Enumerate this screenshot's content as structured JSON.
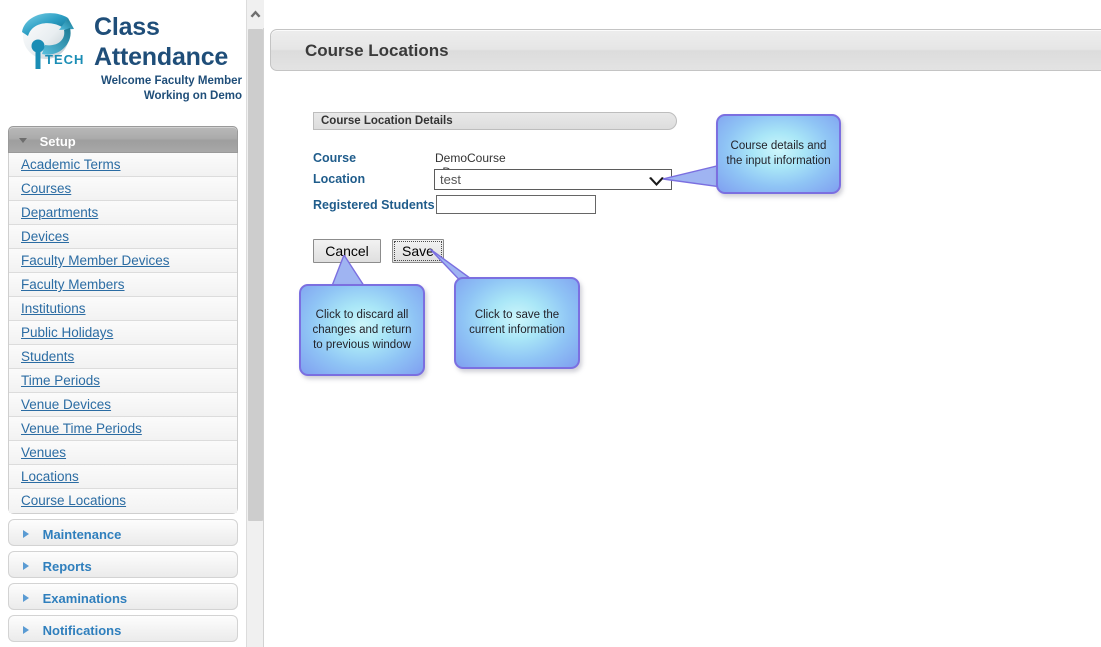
{
  "brand": {
    "logo_icon": "iptech-globe-logo",
    "title_line1": "Class",
    "title_line2": "Attendance",
    "welcome_prefix": "Welcome ",
    "welcome_name": "Faculty Member",
    "welcome_line2": "Working on Demo"
  },
  "sidebar": {
    "sections": [
      {
        "label": "Setup",
        "state": "expanded",
        "toggle_icon": "chevron-down-icon",
        "items": [
          {
            "label": "Academic Terms"
          },
          {
            "label": "Courses"
          },
          {
            "label": "Departments"
          },
          {
            "label": "Devices"
          },
          {
            "label": "Faculty Member Devices"
          },
          {
            "label": "Faculty Members"
          },
          {
            "label": "Institutions"
          },
          {
            "label": "Public Holidays"
          },
          {
            "label": "Students"
          },
          {
            "label": "Time Periods"
          },
          {
            "label": "Venue Devices"
          },
          {
            "label": "Venue Time Periods"
          },
          {
            "label": "Venues"
          },
          {
            "label": "Locations"
          },
          {
            "label": "Course Locations"
          }
        ]
      },
      {
        "label": "Maintenance",
        "state": "collapsed",
        "toggle_icon": "chevron-right-icon"
      },
      {
        "label": "Reports",
        "state": "collapsed",
        "toggle_icon": "chevron-right-icon"
      },
      {
        "label": "Examinations",
        "state": "collapsed",
        "toggle_icon": "chevron-right-icon"
      },
      {
        "label": "Notifications",
        "state": "collapsed",
        "toggle_icon": "chevron-right-icon"
      }
    ]
  },
  "scrollbar": {
    "up_arrow_icon": "chevron-up-icon",
    "orientation": "vertical"
  },
  "page": {
    "title": "Course Locations",
    "panel_title": "Course Location Details"
  },
  "form": {
    "course_label": "Course",
    "course_value": "DemoCourse - Demo Course",
    "location_label": "Location",
    "location_selected": "test",
    "location_options": [
      "test"
    ],
    "location_chevron_icon": "chevron-down-icon",
    "students_label": "Registered Students",
    "students_value": "",
    "students_placeholder": ""
  },
  "buttons": {
    "cancel_label": "Cancel",
    "save_label": "Save",
    "save_focused": true
  },
  "callouts": [
    {
      "id": "details",
      "text": "Course details and the input information",
      "points_to": "location-select"
    },
    {
      "id": "cancel",
      "text": "Click to discard all changes and return to previous window",
      "points_to": "cancel-button"
    },
    {
      "id": "save",
      "text": "Click to save the current information",
      "points_to": "save-button"
    }
  ],
  "colors": {
    "brand_blue": "#1f4e79",
    "link_blue": "#2b6ca3",
    "label_blue": "#1f5c8b",
    "callout_border": "#7b6fe0",
    "callout_fill": "#a9e6f7",
    "header_gray": "#e3e3e3"
  }
}
